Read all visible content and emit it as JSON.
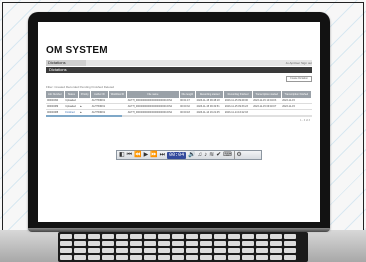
{
  "app": {
    "logo": "OM SYSTEM",
    "tab": "Dictations",
    "title": "Dictations",
    "user_links": "Jo ApiUser   Sign out",
    "create_button": "Create Dictation"
  },
  "filters": "Filter: Created  Recorded  Pending  Finished  Deleted",
  "table": {
    "headers": [
      "Job Number",
      "Status",
      "Priority",
      "Author ID",
      "Workflow ID",
      "File name",
      "File length",
      "Recording started",
      "Recording finished",
      "Transcription started",
      "Transcription finished"
    ],
    "rows": [
      [
        "00000090",
        "Uploaded",
        "",
        "AUTHOR01",
        "",
        "AUTH_0000000000000000000000.DS2",
        "00:01:47",
        "2023-11-15 09:48:18",
        "2023-11-15 09:49:06",
        "2023-11-15 10:04:03",
        "2023-11-15"
      ],
      [
        "00000089",
        "Uploaded",
        "▲",
        "AUTHOR01",
        "",
        "AUTH_0000000000000000000000.DS2",
        "00:00:32",
        "2023-11-15 09:32:51",
        "2023-11-15 09:33:23",
        "2023-11-15 09:40:07",
        "2023-11-15"
      ],
      [
        "00000088",
        "Finished",
        "▲",
        "AUTHOR01",
        "",
        "AUTH_0000000000000000000000.DS2",
        "00:00:18",
        "2023-11-14 16:21:45",
        "2023-11-14 16:22:03",
        "",
        ""
      ]
    ]
  },
  "pager": "1 - 3 of 3",
  "player": {
    "time": "00:04",
    "icons": [
      "speaker-icon",
      "rewind-start-icon",
      "rewind-icon",
      "play-icon",
      "fast-forward-icon",
      "skip-end-icon",
      "volume-icon",
      "speed-icon",
      "tone-icon",
      "noise-filter-icon",
      "check-icon",
      "keyboard-icon",
      "settings-icon"
    ]
  }
}
